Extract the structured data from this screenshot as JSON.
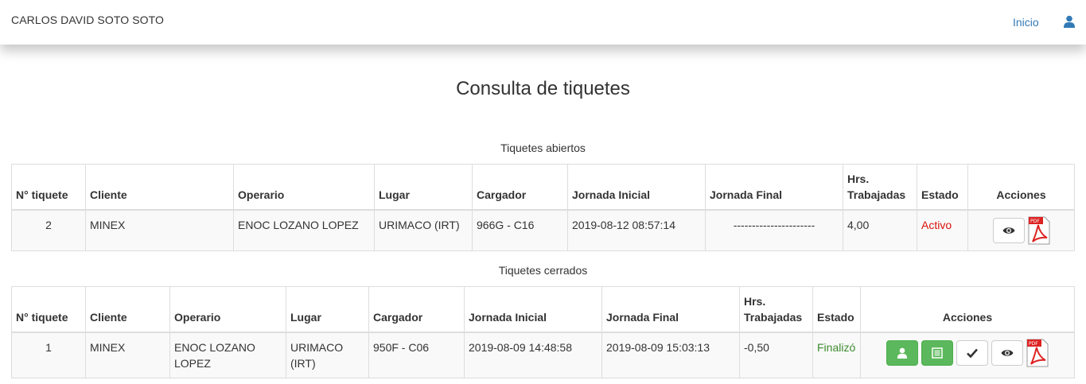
{
  "header": {
    "user_name": "CARLOS DAVID SOTO SOTO",
    "nav_home": "Inicio"
  },
  "page": {
    "title": "Consulta de tiquetes"
  },
  "open_tickets": {
    "caption": "Tiquetes abiertos",
    "columns": [
      "N° tiquete",
      "Cliente",
      "Operario",
      "Lugar",
      "Cargador",
      "Jornada Inicial",
      "Jornada Final",
      "Hrs. Trabajadas",
      "Estado",
      "Acciones"
    ],
    "rows": [
      {
        "numero": "2",
        "cliente": "MINEX",
        "operario": "ENOC LOZANO LOPEZ",
        "lugar": "URIMACO (IRT)",
        "cargador": "966G - C16",
        "jornada_inicial": "2019-08-12 08:57:14",
        "jornada_final": "----------------------",
        "horas": "4,00",
        "estado": "Activo"
      }
    ]
  },
  "closed_tickets": {
    "caption": "Tiquetes cerrados",
    "columns": [
      "N° tiquete",
      "Cliente",
      "Operario",
      "Lugar",
      "Cargador",
      "Jornada Inicial",
      "Jornada Final",
      "Hrs. Trabajadas",
      "Estado",
      "Acciones"
    ],
    "rows": [
      {
        "numero": "1",
        "cliente": "MINEX",
        "operario": "ENOC LOZANO LOPEZ",
        "lugar": "URIMACO (IRT)",
        "cargador": "950F - C06",
        "jornada_inicial": "2019-08-09 14:48:58",
        "jornada_final": "2019-08-09 15:03:13",
        "horas": "-0,50",
        "estado": "Finalizó"
      }
    ]
  },
  "icons": {
    "user": "user-icon",
    "view": "eye-icon",
    "pdf": "pdf-icon",
    "operator": "user-icon",
    "list": "list-icon",
    "approve": "check-icon",
    "pdf_label": "PDF"
  },
  "colors": {
    "link": "#337ab7",
    "active": "#d9120b",
    "finished": "#3c8a2e",
    "success_button": "#5cb85c",
    "pdf_red": "#d22"
  }
}
